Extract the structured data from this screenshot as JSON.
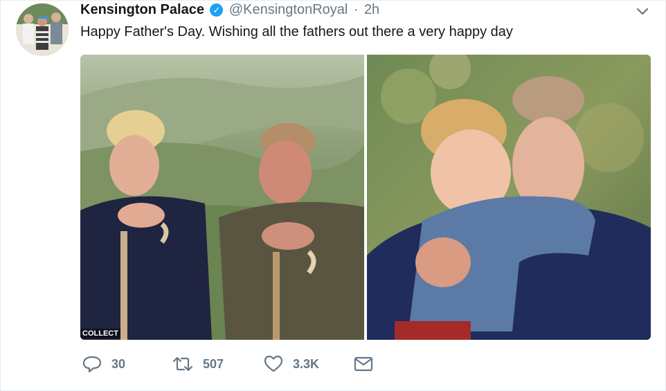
{
  "tweet": {
    "author_name": "Kensington Palace",
    "handle": "@KensingtonRoyal",
    "separator": "·",
    "time": "2h",
    "text": "Happy Father's Day. Wishing all the fathers out there a very happy day",
    "verified_mark": "✓",
    "media": {
      "left_watermark": "COLLECT"
    }
  },
  "actions": {
    "reply_count": "30",
    "retweet_count": "507",
    "like_count": "3.3K"
  },
  "icons": {
    "verified": "verified-badge-icon",
    "caret": "chevron-down-icon",
    "reply": "reply-icon",
    "retweet": "retweet-icon",
    "like": "heart-icon",
    "message": "envelope-icon"
  },
  "colors": {
    "brand_blue": "#1da1f2",
    "text_primary": "#14171a",
    "text_secondary": "#657786",
    "border": "#e6ecf0"
  }
}
